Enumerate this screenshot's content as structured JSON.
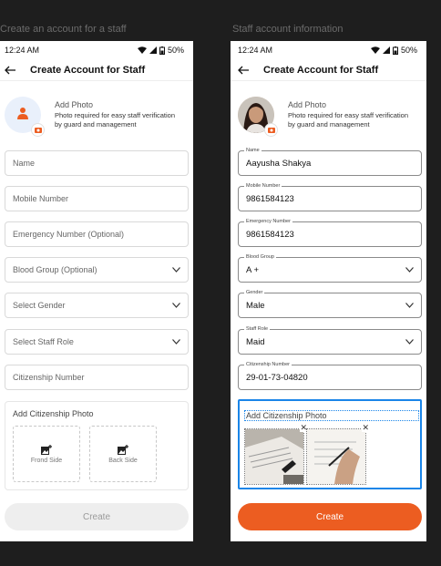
{
  "frames": {
    "left_title": "Create an account for a staff",
    "right_title": "Staff account information"
  },
  "status": {
    "time": "12:24 AM",
    "battery": "50%"
  },
  "appbar": {
    "title": "Create Account for Staff"
  },
  "photo": {
    "title": "Add Photo",
    "desc_line1": "Photo required for easy staff verification",
    "desc_line2": "by guard and management"
  },
  "form_empty": {
    "name": "Name",
    "mobile": "Mobile Number",
    "emergency": "Emergency Number (Optional)",
    "blood": "Blood Group (Optional)",
    "gender": "Select Gender",
    "role": "Select Staff Role",
    "citizenship": "Citizenship Number"
  },
  "form_filled": {
    "name_label": "Name",
    "name_value": "Aayusha Shakya",
    "mobile_label": "Mobile Number",
    "mobile_value": "9861584123",
    "emergency_label": "Emergency Number",
    "emergency_value": "9861584123",
    "blood_label": "Blood Group",
    "blood_value": "A +",
    "gender_label": "Gender",
    "gender_value": "Male",
    "role_label": "Staff Role",
    "role_value": "Maid",
    "citizenship_label": "Citizenship Number",
    "citizenship_value": "29-01-73-04820"
  },
  "citizenship_photo": {
    "title": "Add Citizenship Photo",
    "front": "Frond Side",
    "back": "Back Side"
  },
  "cta": {
    "label": "Create"
  },
  "colors": {
    "accent": "#ec5d21",
    "selection": "#1a85e8"
  }
}
